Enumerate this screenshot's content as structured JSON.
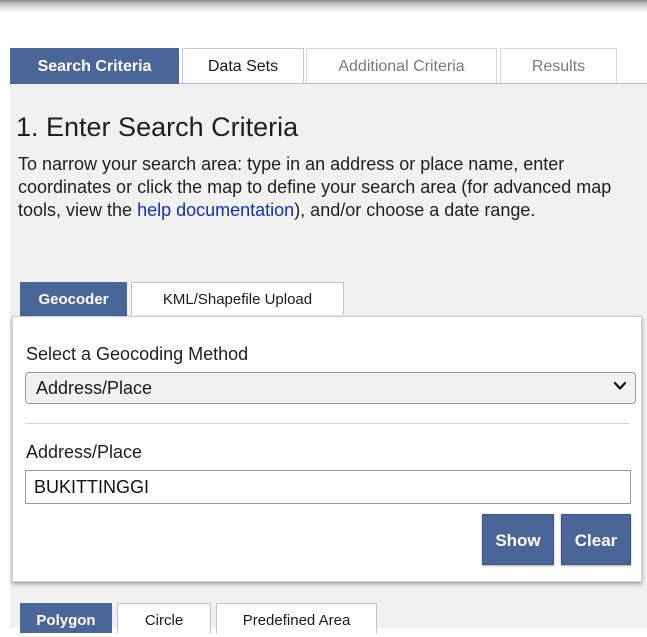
{
  "main_tabs": [
    {
      "label": "Search Criteria"
    },
    {
      "label": "Data Sets"
    },
    {
      "label": "Additional Criteria"
    },
    {
      "label": "Results"
    }
  ],
  "section": {
    "title": "1. Enter Search Criteria",
    "intro_before": "To narrow your search area: type in an address or place name, enter coordinates or click the map to define your search area (for advanced map tools, view the ",
    "help_link": "help documentation",
    "intro_after": "), and/or choose a date range."
  },
  "sub_tabs": [
    {
      "label": "Geocoder"
    },
    {
      "label": "KML/Shapefile Upload"
    }
  ],
  "geocoder": {
    "method_label": "Select a Geocoding Method",
    "method_value": "Address/Place",
    "address_label": "Address/Place",
    "address_value": "BUKITTINGGI",
    "show_label": "Show",
    "clear_label": "Clear"
  },
  "area_tabs": [
    {
      "label": "Polygon"
    },
    {
      "label": "Circle"
    },
    {
      "label": "Predefined Area"
    }
  ],
  "colors": {
    "accent": "#4a6597",
    "link": "#1530b0",
    "panel_bg": "#f1f1f1"
  }
}
